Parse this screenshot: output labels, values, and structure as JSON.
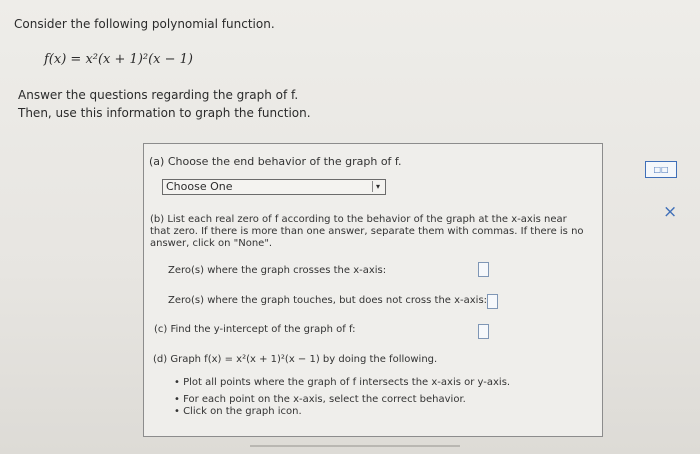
{
  "intro": "Consider the following polynomial function.",
  "function_main": "f(x) = x²(x + 1)²(x − 1)",
  "question_line_1": "Answer the questions regarding the graph of f.",
  "question_line_2": "Then, use this information to graph the function.",
  "part_a": {
    "label": "(a) Choose the end behavior of the graph of f.",
    "select_value": "Choose One"
  },
  "part_b": {
    "label": "(b) List each real zero of f according to the behavior of the graph at the x-axis near that zero. If there is more than one answer, separate them with commas. If there is no answer, click on \"None\".",
    "cross_label": "Zero(s) where the graph crosses the x-axis:",
    "touch_label": "Zero(s) where the graph touches, but does not cross the x-axis:"
  },
  "part_c": {
    "label": "(c) Find the y-intercept of the graph of f:"
  },
  "part_d": {
    "label": "(d) Graph f(x) = x²(x + 1)²(x − 1) by doing the following.",
    "bullets": [
      "Plot all points where the graph of f intersects the x-axis or y-axis.",
      "For each point on the x-axis, select the correct behavior.",
      "Click on the graph icon."
    ]
  },
  "icons": {
    "keyboard": "keyboard-icon",
    "close": "close-icon"
  }
}
